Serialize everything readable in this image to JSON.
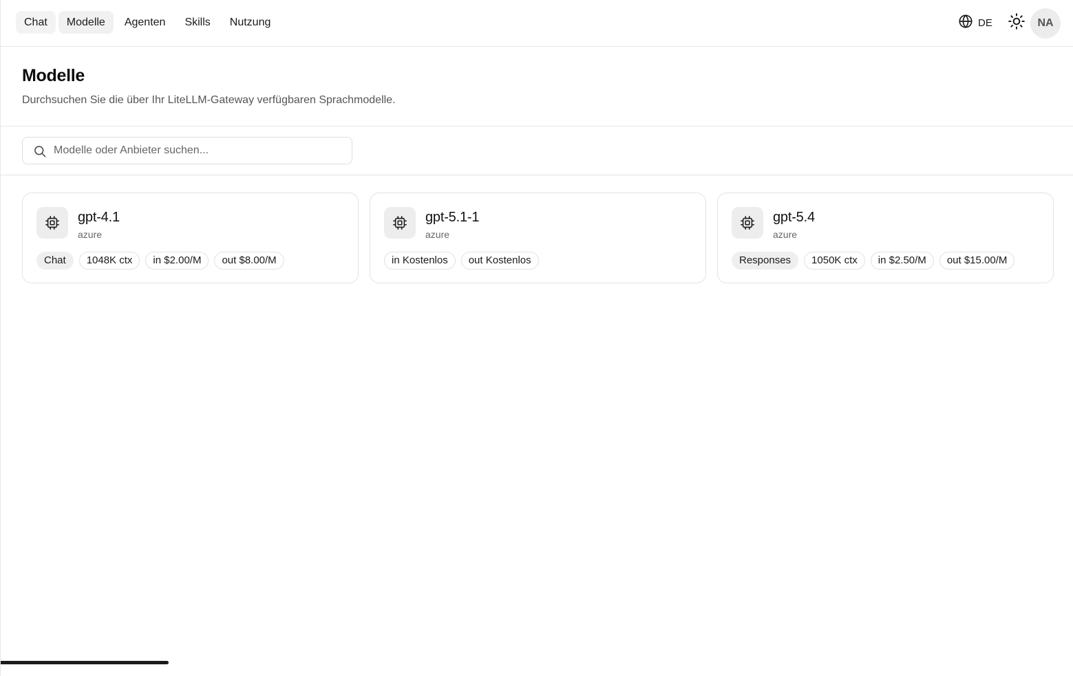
{
  "nav": {
    "items": [
      {
        "label": "Chat"
      },
      {
        "label": "Modelle"
      },
      {
        "label": "Agenten"
      },
      {
        "label": "Skills"
      },
      {
        "label": "Nutzung"
      }
    ],
    "active": "Modelle",
    "language": "DE",
    "avatar_initials": "NA",
    "icons": {
      "language": "globe-icon",
      "theme": "sun-icon"
    }
  },
  "header": {
    "title": "Modelle",
    "subtitle": "Durchsuchen Sie die über Ihr LiteLLM-Gateway verfügbaren Sprachmodelle."
  },
  "search": {
    "placeholder": "Modelle oder Anbieter suchen...",
    "value": ""
  },
  "models": [
    {
      "name": "gpt-4.1",
      "provider": "azure",
      "tags": [
        {
          "label": "Chat",
          "kind": "mode"
        },
        {
          "label": "1048K ctx",
          "kind": "info"
        },
        {
          "label": "in $2.00/M",
          "kind": "info"
        },
        {
          "label": "out $8.00/M",
          "kind": "info"
        }
      ]
    },
    {
      "name": "gpt-5.1-1",
      "provider": "azure",
      "tags": [
        {
          "label": "in Kostenlos",
          "kind": "info"
        },
        {
          "label": "out Kostenlos",
          "kind": "info"
        }
      ]
    },
    {
      "name": "gpt-5.4",
      "provider": "azure",
      "tags": [
        {
          "label": "Responses",
          "kind": "mode"
        },
        {
          "label": "1050K ctx",
          "kind": "info"
        },
        {
          "label": "in $2.50/M",
          "kind": "info"
        },
        {
          "label": "out $15.00/M",
          "kind": "info"
        }
      ]
    }
  ]
}
